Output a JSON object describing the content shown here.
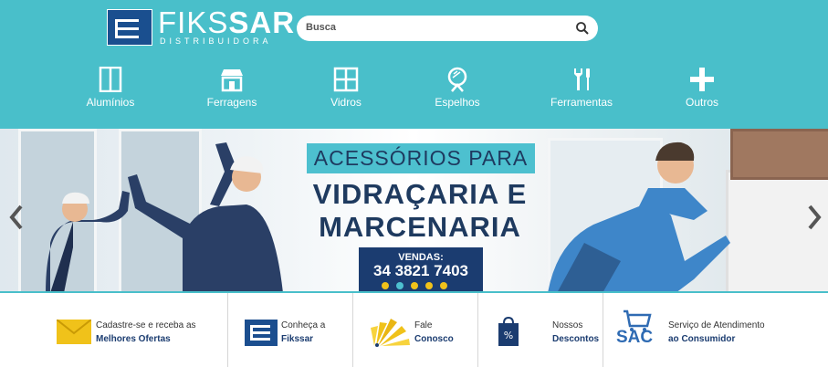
{
  "brand": {
    "name_a": "FIKS",
    "name_b": "SAR",
    "subtitle": "DISTRIBUIDORA"
  },
  "search": {
    "placeholder": "Busca"
  },
  "categories": [
    {
      "label": "Alumínios",
      "icon": "window-frame-icon"
    },
    {
      "label": "Ferragens",
      "icon": "storefront-icon"
    },
    {
      "label": "Vidros",
      "icon": "window-grid-icon"
    },
    {
      "label": "Espelhos",
      "icon": "mirror-icon"
    },
    {
      "label": "Ferramentas",
      "icon": "tools-icon"
    },
    {
      "label": "Outros",
      "icon": "plus-icon"
    }
  ],
  "banner": {
    "headline": "ACESSÓRIOS PARA",
    "title_line1": "VIDRAÇARIA E",
    "title_line2": "MARCENARIA",
    "sales_label": "VENDAS:",
    "sales_phone": "34 3821 7403",
    "slide_count": 5,
    "active_slide": 2
  },
  "features": [
    {
      "line1": "Cadastre-se e receba as",
      "line2": "Melhores Ofertas",
      "icon": "envelope-icon"
    },
    {
      "line1": "Conheça a",
      "line2": "Fikssar",
      "icon": "fikssar-logo-icon"
    },
    {
      "line1": "Fale",
      "line2": "Conosco",
      "icon": "color-fan-icon"
    },
    {
      "line1": "Nossos",
      "line2": "Descontos",
      "icon": "discount-bag-icon"
    },
    {
      "line1": "Serviço de Atendimento",
      "line2": "ao Consumidor",
      "icon": "sac-cart-icon",
      "badge": "SAC"
    }
  ],
  "colors": {
    "header": "#49bfca",
    "navy": "#1b3c70",
    "yellow": "#f0c21a"
  }
}
